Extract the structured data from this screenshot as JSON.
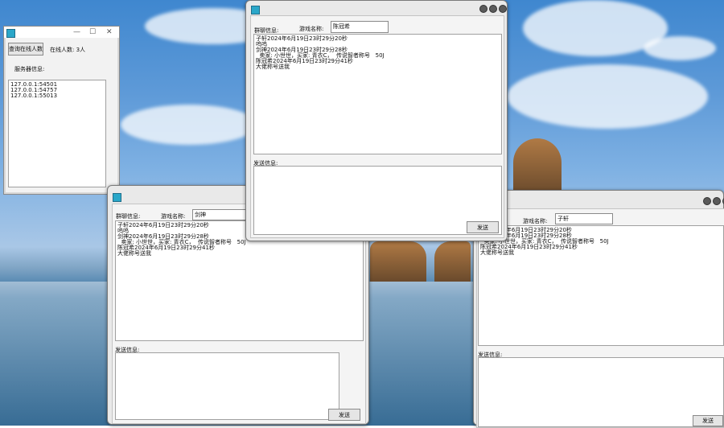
{
  "server_window": {
    "controls": {
      "minimize": "—",
      "maximize": "☐",
      "close": "✕"
    },
    "query_button": "查询在线人数",
    "online_count": "在线人数: 3人",
    "server_info_label": "服务器信息:",
    "addresses": [
      "127.0.0.1:54501",
      "127.0.0.1:54757",
      "127.0.0.1:55013"
    ]
  },
  "chat_window_top": {
    "group_label": "群聊信息:",
    "game_name_label": "游戏名称:",
    "game_name_value": "陈冠希",
    "messages": [
      "子轩2024年6月19日23时29分20秒",
      "呜呜",
      "",
      "剑神2024年6月19日23时29分28秒",
      "  卖家: 小世世，买家: 青衣C，  传说智者称号   50J",
      "陈冠希2024年6月19日23时29分41秒",
      "大佬称号送我"
    ],
    "send_label": "发送信息:",
    "send_button": "发送"
  },
  "chat_window_left": {
    "group_label": "群聊信息:",
    "game_name_label": "游戏名称:",
    "game_name_value": "剑神",
    "messages": [
      "子轩2024年6月19日23时29分20秒",
      "呜呜",
      "",
      "剑神2024年6月19日23时29分28秒",
      "  卖家: 小世世，买家: 青衣C，  传说智者称号   50J",
      "陈冠希2024年6月19日23时29分41秒",
      "大佬称号送我"
    ],
    "send_label": "发送信息:",
    "send_button": "发送"
  },
  "chat_window_right": {
    "game_name_label": "游戏名称:",
    "game_name_value": "子轩",
    "messages": [
      "子轩2024年6月19日23时29分20秒",
      "",
      "剑神2024年6月19日23时29分28秒",
      "  卖家: 小世世，买家: 青衣C，  传说智者称号   50J",
      "陈冠希2024年6月19日23时29分41秒",
      "大佬称号送我"
    ],
    "send_label": "发送信息:",
    "send_button": "发送"
  },
  "colors": {
    "window_bg": "#f4f4f4",
    "frame": "#e9e9e9",
    "sky": "#5e9ad8"
  }
}
